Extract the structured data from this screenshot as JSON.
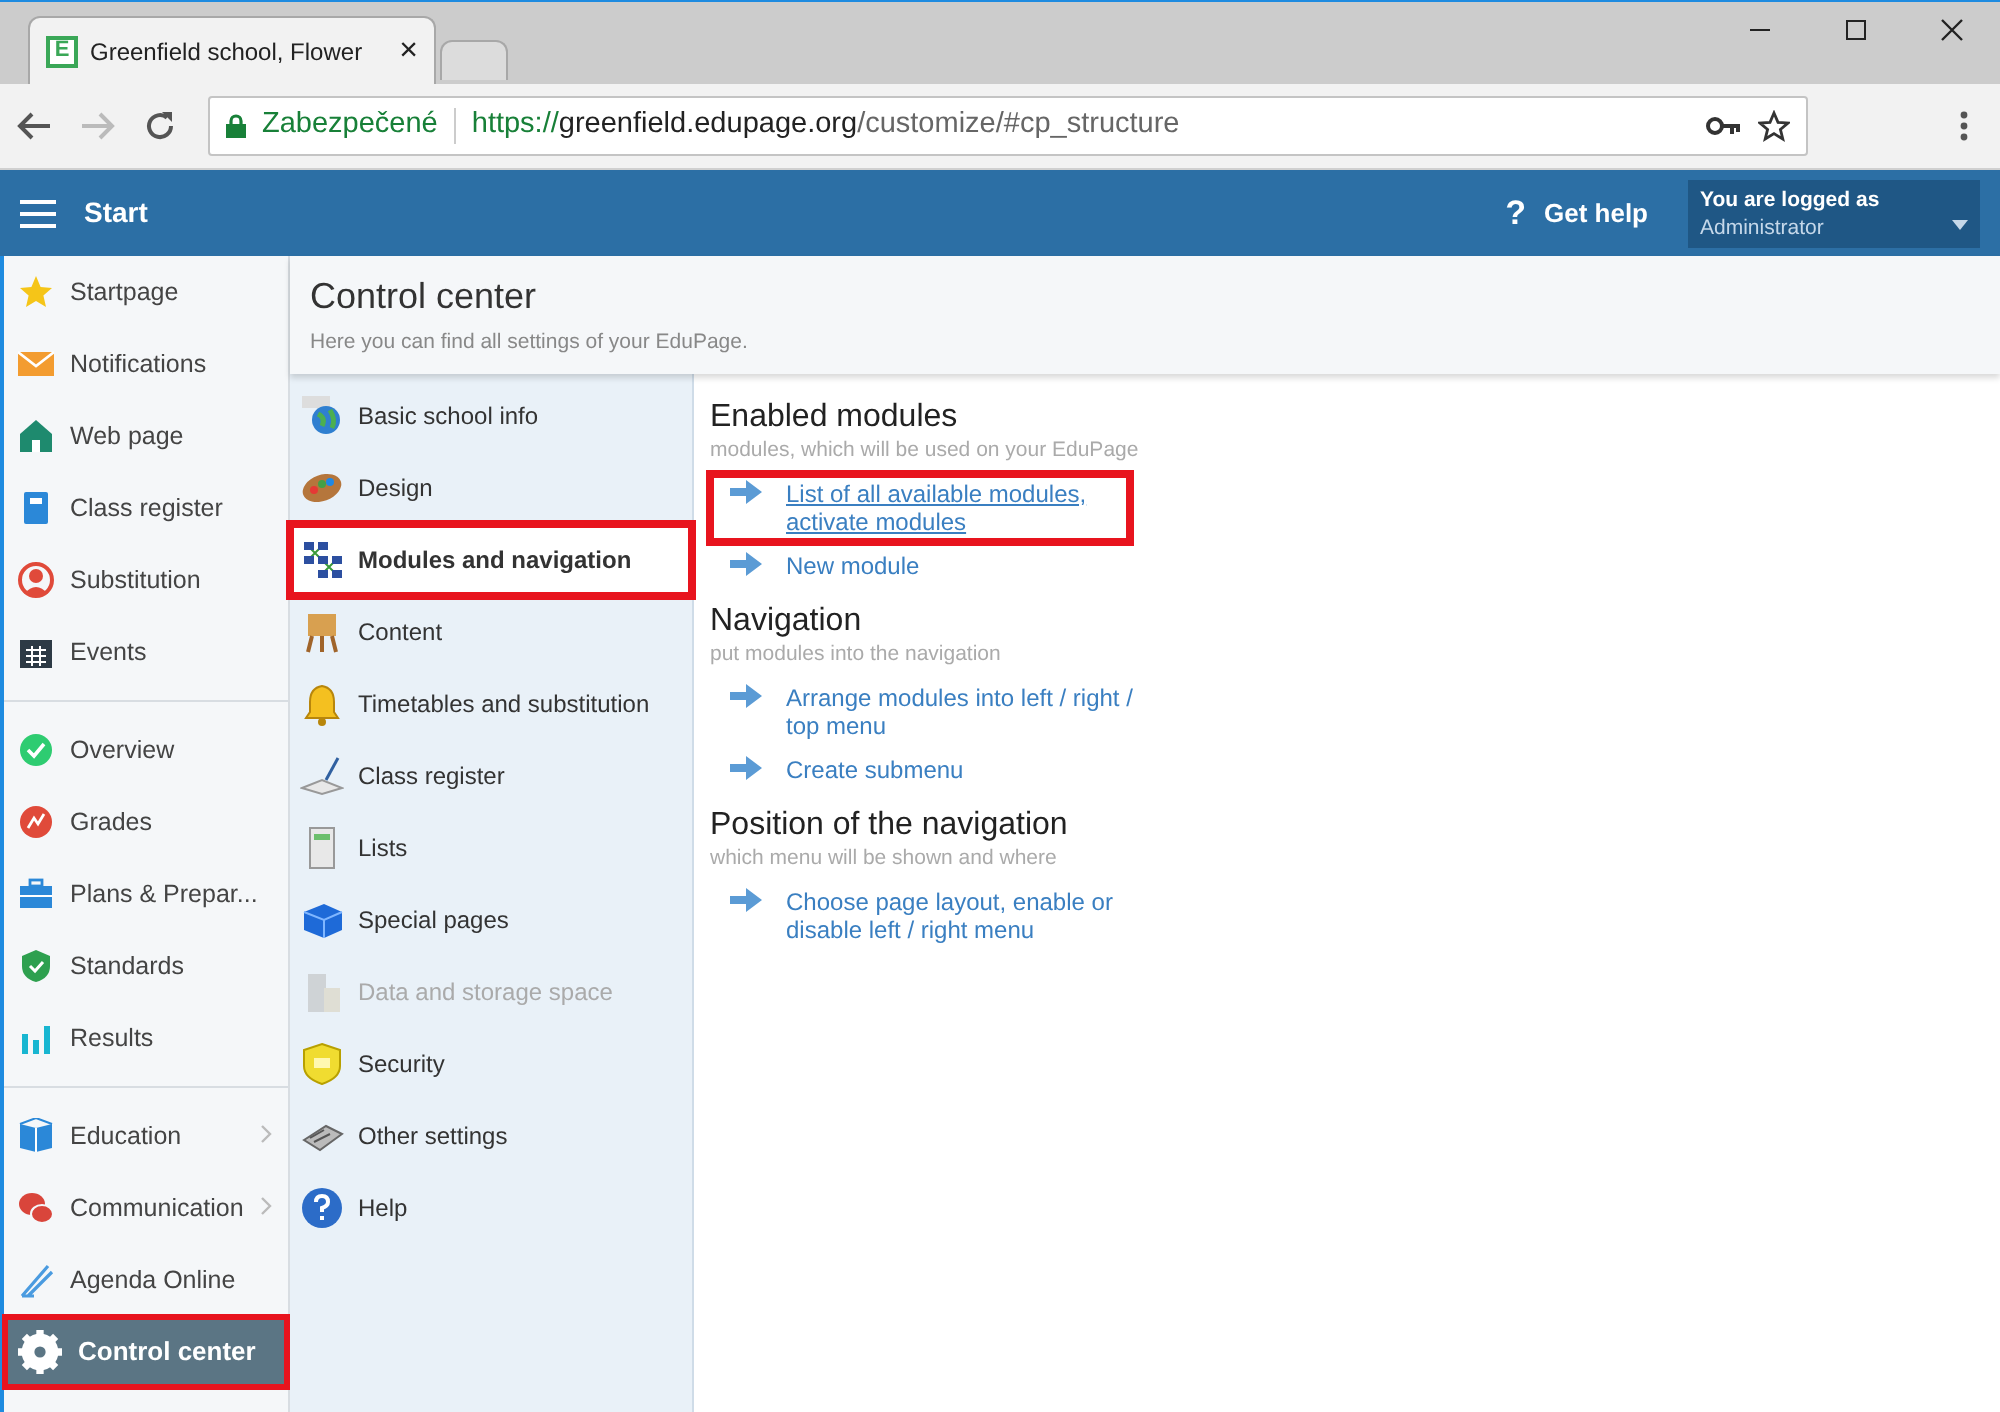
{
  "browser": {
    "tabs": [
      {
        "favicon": "E",
        "title": "Greenfield school, Flower",
        "selected": true,
        "close": "×"
      },
      {
        "selected": false
      }
    ],
    "security_label": "Zabezpečené",
    "url": {
      "scheme": "https://",
      "host": "greenfield.edupage.org",
      "path": "/customize/#cp_structure"
    },
    "forward_disabled": true
  },
  "header": {
    "menu_label": "Start",
    "help_icon": "?",
    "help_label": "Get help",
    "user": {
      "caption": "You are logged as",
      "role": "Administrator"
    }
  },
  "sidebar": {
    "groups": [
      [
        {
          "label": "Startpage",
          "selected": false,
          "highlighted": false,
          "submenu": false
        },
        {
          "label": "Notifications",
          "selected": false,
          "highlighted": false,
          "submenu": false
        },
        {
          "label": "Web page",
          "selected": false,
          "highlighted": false,
          "submenu": false
        },
        {
          "label": "Class register",
          "selected": false,
          "highlighted": false,
          "submenu": false
        },
        {
          "label": "Substitution",
          "selected": false,
          "highlighted": false,
          "submenu": false
        },
        {
          "label": "Events",
          "selected": false,
          "highlighted": false,
          "submenu": false
        }
      ],
      [
        {
          "label": "Overview",
          "selected": false,
          "highlighted": false,
          "submenu": false
        },
        {
          "label": "Grades",
          "selected": false,
          "highlighted": false,
          "submenu": false
        },
        {
          "label": "Plans & Prepar...",
          "selected": false,
          "highlighted": false,
          "submenu": false
        },
        {
          "label": "Standards",
          "selected": false,
          "highlighted": false,
          "submenu": false
        },
        {
          "label": "Results",
          "selected": false,
          "highlighted": false,
          "submenu": false
        }
      ],
      [
        {
          "label": "Education",
          "selected": false,
          "highlighted": false,
          "submenu": true
        },
        {
          "label": "Communication",
          "selected": false,
          "highlighted": false,
          "submenu": true
        },
        {
          "label": "Agenda Online",
          "selected": false,
          "highlighted": false,
          "submenu": false
        },
        {
          "label": "Control center",
          "selected": true,
          "highlighted": true,
          "submenu": false
        }
      ]
    ]
  },
  "page": {
    "title": "Control center",
    "subtitle": "Here you can find all settings of your EduPage."
  },
  "settings_menu": [
    {
      "label": "Basic school info",
      "selected": false,
      "highlighted": false,
      "disabled": false
    },
    {
      "label": "Design",
      "selected": false,
      "highlighted": false,
      "disabled": false
    },
    {
      "label": "Modules and navigation",
      "selected": true,
      "highlighted": true,
      "disabled": false
    },
    {
      "label": "Content",
      "selected": false,
      "highlighted": false,
      "disabled": false
    },
    {
      "label": "Timetables and substitution",
      "selected": false,
      "highlighted": false,
      "disabled": false
    },
    {
      "label": "Class register",
      "selected": false,
      "highlighted": false,
      "disabled": false
    },
    {
      "label": "Lists",
      "selected": false,
      "highlighted": false,
      "disabled": false
    },
    {
      "label": "Special pages",
      "selected": false,
      "highlighted": false,
      "disabled": false
    },
    {
      "label": "Data and storage space",
      "selected": false,
      "highlighted": false,
      "disabled": true
    },
    {
      "label": "Security",
      "selected": false,
      "highlighted": false,
      "disabled": false
    },
    {
      "label": "Other settings",
      "selected": false,
      "highlighted": false,
      "disabled": false
    },
    {
      "label": "Help",
      "selected": false,
      "highlighted": false,
      "disabled": false
    }
  ],
  "sections": [
    {
      "title": "Enabled modules",
      "subtitle": "modules, which will be used on your EduPage",
      "links": [
        {
          "text": "List of all available modules, activate modules",
          "highlighted": true
        },
        {
          "text": "New module",
          "highlighted": false
        }
      ]
    },
    {
      "title": "Navigation",
      "subtitle": "put modules into the navigation",
      "links": [
        {
          "text": "Arrange modules into left / right / top menu",
          "highlighted": false
        },
        {
          "text": "Create submenu",
          "highlighted": false
        }
      ]
    },
    {
      "title": "Position of the navigation",
      "subtitle": "which menu will be shown and where",
      "links": [
        {
          "text": "Choose page layout, enable or disable left / right menu",
          "highlighted": false
        }
      ]
    }
  ]
}
